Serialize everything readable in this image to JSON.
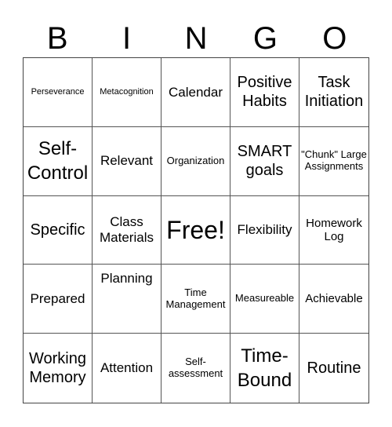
{
  "header": [
    "B",
    "I",
    "N",
    "G",
    "O"
  ],
  "cells": [
    "Perseverance",
    "Metacognition",
    "Calendar",
    "Positive Habits",
    "Task Initiation",
    "Self-Control",
    "Relevant",
    "Organization",
    "SMART goals",
    "\"Chunk\" Large Assignments",
    "Specific",
    "Class Materials",
    "Free!",
    "Flexibility",
    "Homework Log",
    "Prepared",
    "Planning",
    "Time Management",
    "Measureable",
    "Achievable",
    "Working Memory",
    "Attention",
    "Self-assessment",
    "Time-Bound",
    "Routine"
  ]
}
